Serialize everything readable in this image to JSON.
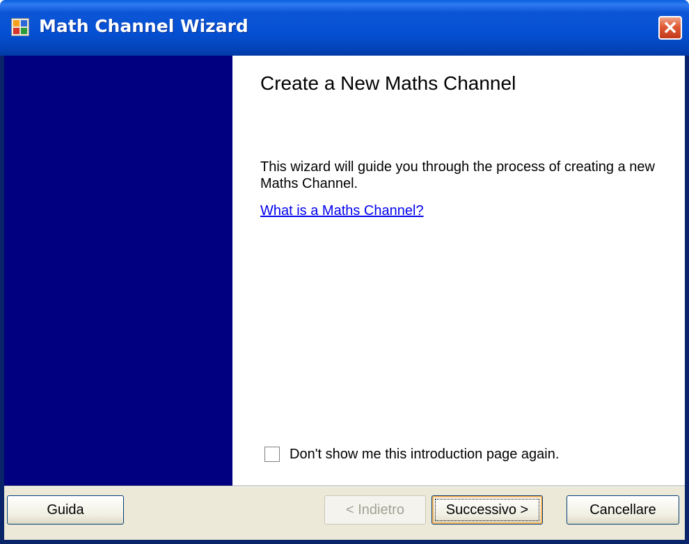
{
  "window": {
    "title": "Math Channel Wizard",
    "app_icon": "wizard-app-icon",
    "close_icon": "close-icon"
  },
  "page": {
    "heading": "Create a New Maths Channel",
    "description": "This wizard will guide you through the process of creating a new Maths Channel.",
    "help_link": "What is a Maths Channel?"
  },
  "options": {
    "dont_show_label": "Don't show me this introduction page again.",
    "dont_show_checked": false
  },
  "buttons": {
    "help": "Guida",
    "back": "< Indietro",
    "back_enabled": false,
    "next": "Successivo >",
    "cancel": "Cancellare"
  },
  "colors": {
    "side_panel": "#000080",
    "title_bar": "#0450d3",
    "link": "#0000ee"
  }
}
